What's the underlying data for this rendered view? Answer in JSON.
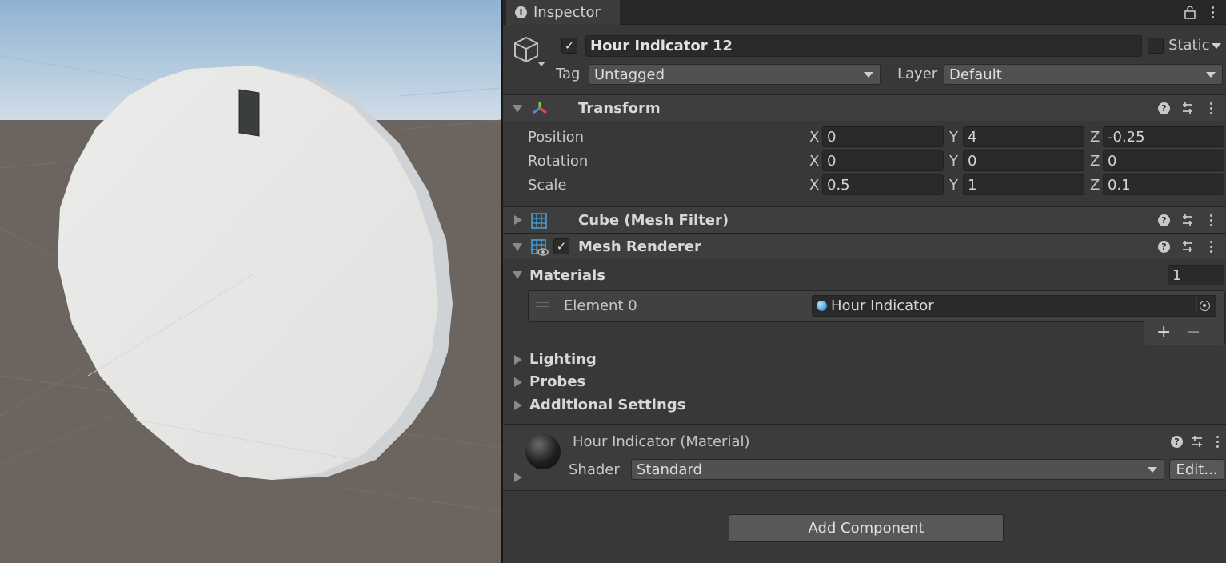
{
  "inspector": {
    "tab_label": "Inspector",
    "object": {
      "name": "Hour Indicator 12",
      "active": true,
      "static_label": "Static",
      "tag_label": "Tag",
      "tag_value": "Untagged",
      "layer_label": "Layer",
      "layer_value": "Default"
    },
    "transform": {
      "title": "Transform",
      "rows": [
        {
          "label": "Position",
          "x": "0",
          "y": "4",
          "z": "-0.25"
        },
        {
          "label": "Rotation",
          "x": "0",
          "y": "0",
          "z": "0"
        },
        {
          "label": "Scale",
          "x": "0.5",
          "y": "1",
          "z": "0.1"
        }
      ],
      "axis_x": "X",
      "axis_y": "Y",
      "axis_z": "Z"
    },
    "mesh_filter": {
      "title": "Cube (Mesh Filter)"
    },
    "mesh_renderer": {
      "title": "Mesh Renderer",
      "enabled": true,
      "materials_label": "Materials",
      "materials_count": "1",
      "element_label": "Element 0",
      "element_value": "Hour Indicator",
      "add_symbol": "+",
      "remove_symbol": "−",
      "sections": [
        "Lighting",
        "Probes",
        "Additional Settings"
      ]
    },
    "material": {
      "title": "Hour Indicator (Material)",
      "shader_label": "Shader",
      "shader_value": "Standard",
      "edit_label": "Edit..."
    },
    "add_component_label": "Add Component",
    "colors": {
      "panel_bg": "#383838",
      "header_bg": "#3e3e3e",
      "field_bg": "#2a2a2a",
      "accent_blue": "#4aa3df"
    }
  },
  "scene": {
    "description_icon": "clock-face-scene",
    "colors": {
      "sky": "#c9d8e6",
      "ground": "#6d655f",
      "clock_face": "#e8e8e6",
      "indicator": "#3a3d3d"
    }
  }
}
